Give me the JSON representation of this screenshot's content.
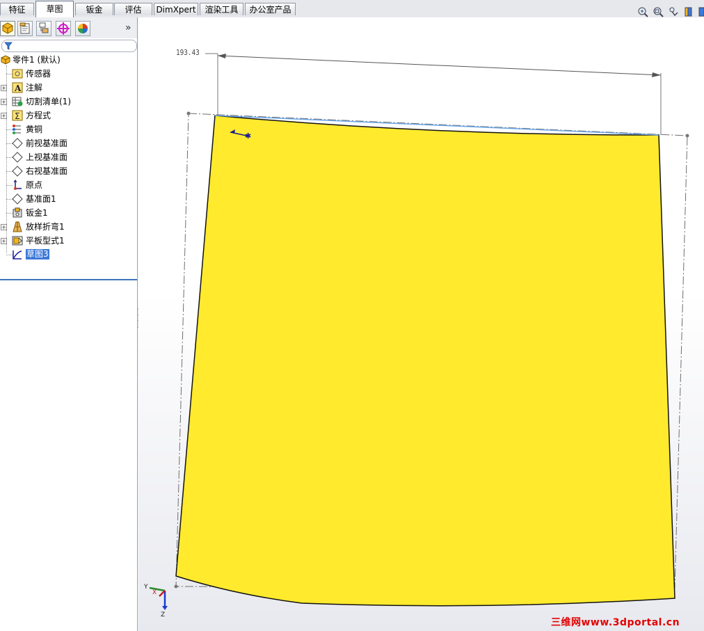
{
  "command_tabs": [
    {
      "label": "特征"
    },
    {
      "label": "草图",
      "active": true
    },
    {
      "label": "钣金"
    },
    {
      "label": "评估"
    },
    {
      "label": "DimXpert"
    },
    {
      "label": "渲染工具"
    },
    {
      "label": "办公室产品"
    }
  ],
  "panel": {
    "expand_label": "»",
    "tree": [
      {
        "label": "零件1  (默认)",
        "icon": "part-icon"
      },
      {
        "label": "传感器",
        "icon": "sensor-icon"
      },
      {
        "label": "注解",
        "icon": "annotation-icon"
      },
      {
        "label": "切割清单(1)",
        "icon": "cutlist-icon"
      },
      {
        "label": "方程式",
        "icon": "equation-icon"
      },
      {
        "label": "黄铜",
        "icon": "material-icon"
      },
      {
        "label": "前视基准面",
        "icon": "plane-icon"
      },
      {
        "label": "上视基准面",
        "icon": "plane-icon"
      },
      {
        "label": "右视基准面",
        "icon": "plane-icon"
      },
      {
        "label": "原点",
        "icon": "origin-icon"
      },
      {
        "label": "基准面1",
        "icon": "plane-icon"
      },
      {
        "label": "钣金1",
        "icon": "sheetmetal-icon"
      },
      {
        "label": "放样折弯1",
        "icon": "loft-bend-icon"
      },
      {
        "label": "平板型式1",
        "icon": "flat-pattern-icon"
      },
      {
        "label": "草图3",
        "icon": "sketch-icon",
        "selected": true
      }
    ]
  },
  "viewport": {
    "dimension_value": "193.43",
    "triad": {
      "y_label": "Y",
      "x_label": "X",
      "z_label": "Z"
    },
    "sketch_fill_color": "#ffea2e"
  },
  "watermark": "三维网www.3dportal.cn"
}
